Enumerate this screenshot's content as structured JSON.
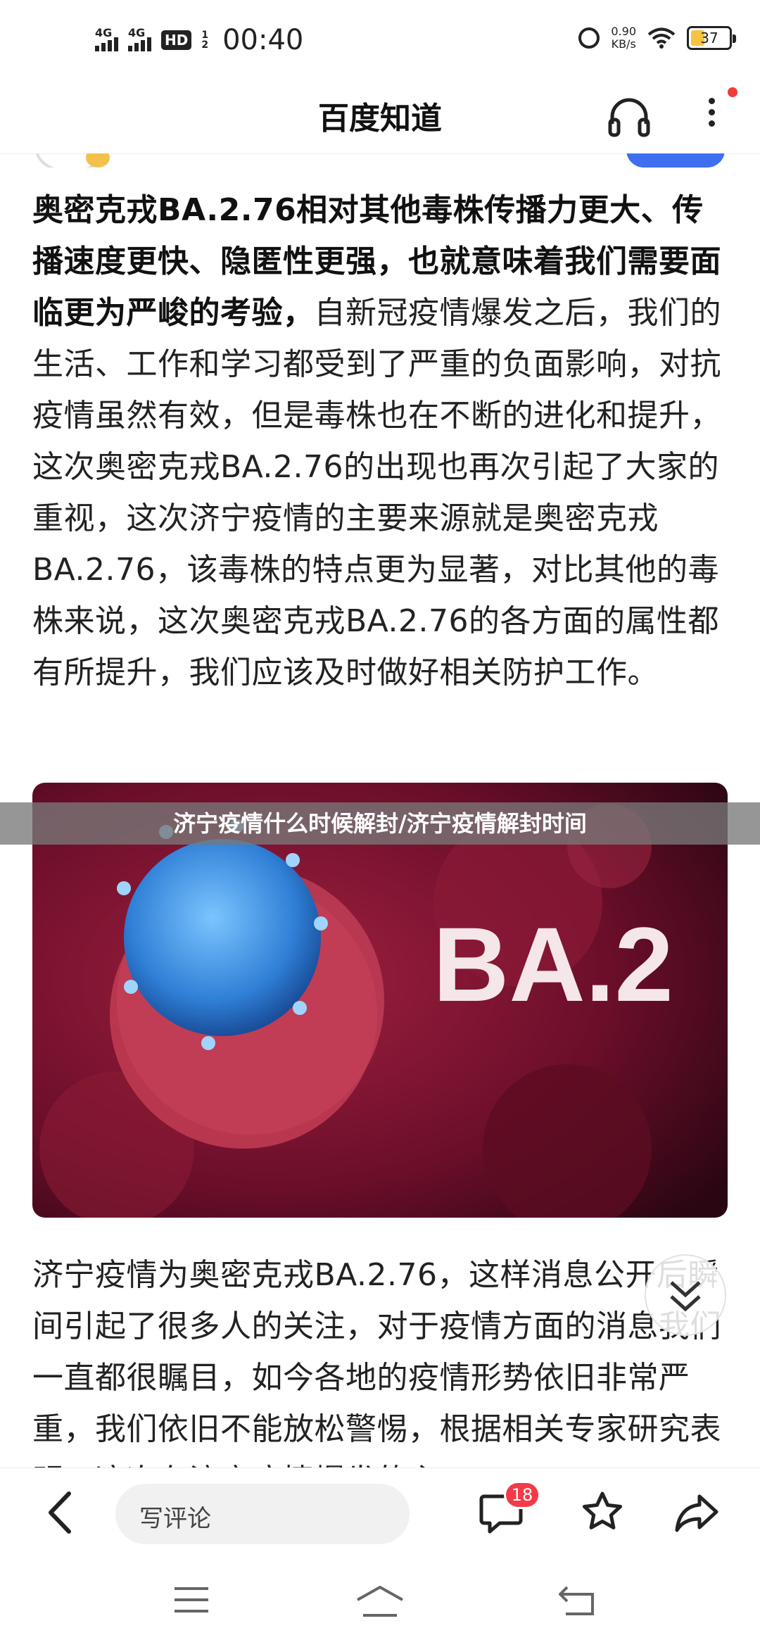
{
  "status_bar": {
    "signal1": "4G",
    "signal2": "4G",
    "hd": "HD",
    "hd_sub1": "1",
    "hd_sub2": "2",
    "time": "00:40",
    "speed_value": "0.90",
    "speed_unit": "KB/s",
    "battery": "37",
    "battery_level": 0.37
  },
  "header": {
    "title": "百度知道"
  },
  "article": {
    "bold_intro": "奥密克戎BA.2.76相对其他毒株传播力更大、传播速度更快、隐匿性更强，也就意味着我们需要面临更为严峻的考验，",
    "paragraph1_rest": "自新冠疫情爆发之后，我们的生活、工作和学习都受到了严重的负面影响，对抗疫情虽然有效，但是毒株也在不断的进化和提升，这次奥密克戎BA.2.76的出现也再次引起了大家的重视，这次济宁疫情的主要来源就是奥密克戎BA.2.76，该毒株的特点更为显著，对比其他的毒株来说，这次奥密克戎BA.2.76的各方面的属性都有所提升，我们应该及时做好相关防护工作。",
    "image_text": "BA.2",
    "overlay_title": "济宁疫情什么时候解封/济宁疫情解封时间",
    "paragraph2": "济宁疫情为奥密克戎BA.2.76，这样消息公开后瞬间引起了很多人的关注，对于疫情方面的消息我们一直都很瞩目，如今各地的疫情形势依旧非常严重，我们依旧不能放松警惕，根据相关专家研究表明，这次在济宁疫情爆发的主"
  },
  "action_bar": {
    "comment_placeholder": "写评论",
    "comment_count": "18"
  },
  "icons": {
    "back": "back-arrow-icon",
    "chat": "comment-bubble-icon",
    "star": "star-outline-icon",
    "share": "share-arrow-icon",
    "headphone": "headphone-icon",
    "more": "more-vertical-icon",
    "scroll": "double-chevron-down-icon"
  },
  "colors": {
    "badge": "#f23b48",
    "notification_dot": "#f23a3a",
    "battery_fill": "#f6c342",
    "image_bg": "#6b0e2a",
    "virus_blue": "#3b8fe0"
  }
}
